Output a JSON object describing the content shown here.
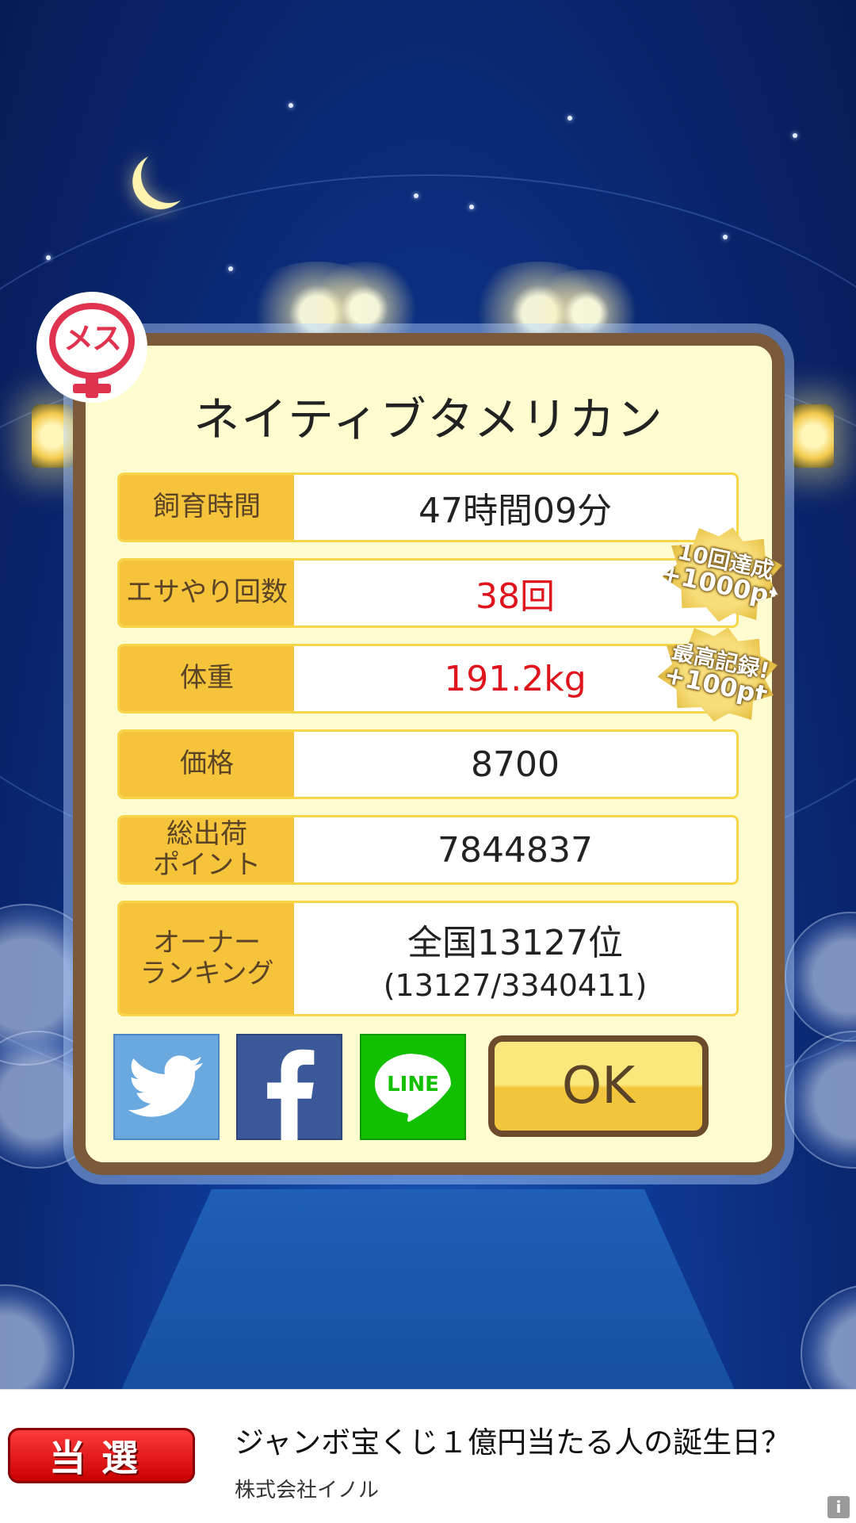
{
  "pig": {
    "gender_label": "メス",
    "name": "ネイティブタメリカン"
  },
  "stats": [
    {
      "label": "飼育時間",
      "value": "47時間09分"
    },
    {
      "label": "エサやり回数",
      "value": "38回"
    },
    {
      "label": "体重",
      "value": "191.2kg"
    },
    {
      "label": "価格",
      "value": "8700"
    },
    {
      "label_line1": "総出荷",
      "label_line2": "ポイント",
      "value": "7844837"
    },
    {
      "label_line1": "オーナー",
      "label_line2": "ランキング",
      "value": "全国13127位",
      "value_sub": "(13127/3340411)"
    }
  ],
  "bonuses": [
    {
      "line1": "10回達成",
      "line2": "+1000pt"
    },
    {
      "line1": "最高記録!",
      "line2": "+100pt"
    }
  ],
  "share": {
    "twitter_icon": "twitter-bird-icon",
    "facebook_icon": "facebook-f-icon",
    "line_label": "LINE"
  },
  "ok_label": "OK",
  "ad": {
    "logo_text": "当選",
    "title": "ジャンボ宝くじ１億円当たる人の誕生日？",
    "sponsor": "株式会社イノル",
    "info_label": "i"
  },
  "colors": {
    "accent_red": "#e0141c",
    "label_gold": "#f5c43a",
    "frame_brown": "#7a5a3a",
    "twitter_blue": "#6aa9e0",
    "facebook_blue": "#3b5998",
    "line_green": "#13c000"
  }
}
